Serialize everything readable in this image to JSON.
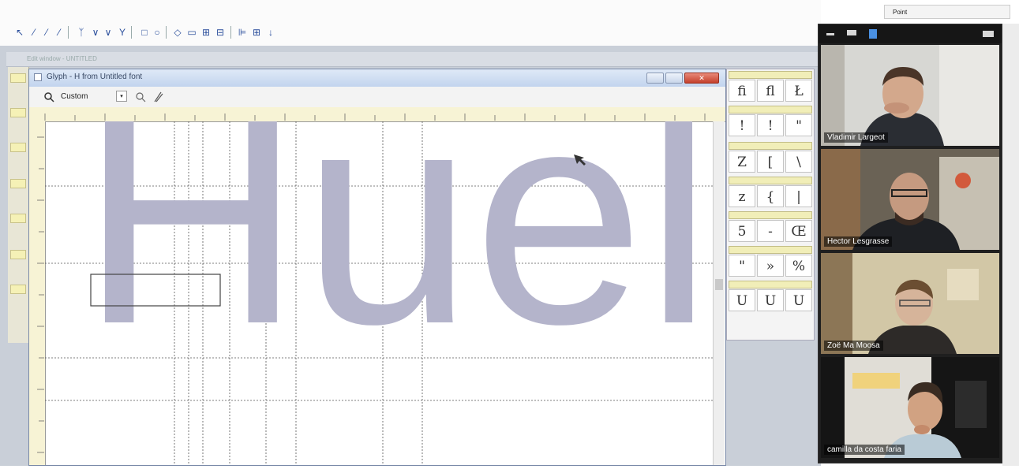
{
  "top_right_field": "Point",
  "document_tabs_label": "Edit window - UNTITLED",
  "glyph_window": {
    "title": "Glyph - H from Untitled font",
    "zoom_value": "Custom",
    "combo_arrow": "▾",
    "close_glyph": "✕",
    "glyph_text": "Huelg"
  },
  "glyph_table": {
    "rows": [
      [
        "fi",
        "fl",
        "Ł"
      ],
      [
        "!",
        "!",
        "\""
      ],
      [
        "Z",
        "[",
        "\\"
      ],
      [
        "z",
        "{",
        "|"
      ],
      [
        "5",
        "-",
        "Œ"
      ],
      [
        "\"",
        "»",
        "%"
      ],
      [
        "U",
        "U",
        "U"
      ]
    ]
  },
  "participants": [
    {
      "name": "Vladimir Largeot"
    },
    {
      "name": "Hector Lesgrasse"
    },
    {
      "name": "Zoë Ma Moosa"
    },
    {
      "name": "camilla da costa faria"
    }
  ],
  "colors": {
    "glyph_fill": "#b4b4cb",
    "active_speaker_border": "#7dbb3c",
    "toolbar_icon": "#2b4f9c",
    "ruler": "#f7f3d5"
  },
  "icons": [
    "pointer-icon",
    "pen-icon",
    "knife-icon",
    "zoom-icon",
    "minimize-icon",
    "maximize-icon",
    "close-icon"
  ]
}
